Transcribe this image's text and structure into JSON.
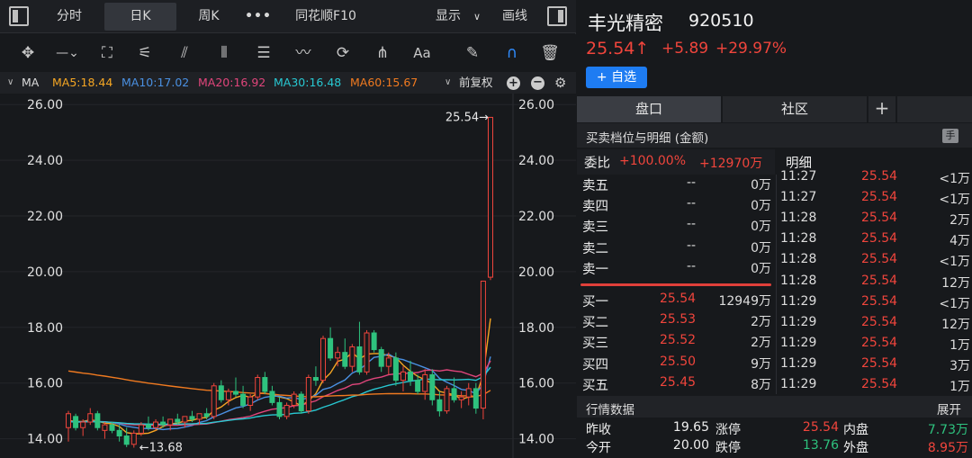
{
  "toolbar_top": {
    "tabs": [
      "分时",
      "日K",
      "周K",
      "•••",
      "同花顺F10"
    ],
    "display_label": "显示",
    "draw_label": "画线"
  },
  "drawing_tools": [
    "crosshair-icon",
    "horizontal-line-icon",
    "rectangle-icon",
    "fan-icon",
    "parallel-channel-icon",
    "vertical-lines-icon",
    "text-box-icon",
    "wave-icon",
    "cycle-icon",
    "fork-icon",
    "font-icon",
    "pen-icon",
    "magnet-icon",
    "trash-icon"
  ],
  "drawing_tool_labels": {
    "font": "Aa"
  },
  "ma_bar": {
    "label": "MA",
    "items": [
      {
        "text": "MA5:18.44",
        "color": "#f5a623"
      },
      {
        "text": "MA10:17.02",
        "color": "#4a90e2"
      },
      {
        "text": "MA20:16.92",
        "color": "#e0457b"
      },
      {
        "text": "MA30:16.48",
        "color": "#28c8d2"
      },
      {
        "text": "MA60:15.67",
        "color": "#f07a20"
      }
    ],
    "adjust": "前复权"
  },
  "chart_data": {
    "type": "candlestick",
    "ylim": [
      13.6,
      26.2
    ],
    "yticks": [
      "26.00",
      "24.00",
      "22.00",
      "20.00",
      "18.00",
      "16.00",
      "14.00"
    ],
    "annotations": {
      "high": "25.54→",
      "low": "←13.68"
    },
    "ohlc": [
      [
        14.4,
        15.0,
        13.9,
        14.9
      ],
      [
        14.8,
        14.9,
        14.3,
        14.4
      ],
      [
        14.4,
        14.7,
        14.1,
        14.6
      ],
      [
        14.6,
        15.1,
        14.5,
        14.9
      ],
      [
        14.9,
        15.0,
        14.3,
        14.4
      ],
      [
        14.3,
        14.6,
        14.0,
        14.5
      ],
      [
        14.5,
        14.6,
        14.2,
        14.3
      ],
      [
        14.3,
        14.5,
        13.9,
        14.1
      ],
      [
        14.1,
        14.4,
        13.7,
        13.8
      ],
      [
        13.8,
        14.3,
        13.68,
        14.2
      ],
      [
        14.2,
        14.6,
        14.1,
        14.5
      ],
      [
        14.5,
        14.8,
        14.3,
        14.4
      ],
      [
        14.4,
        14.7,
        14.3,
        14.6
      ],
      [
        14.6,
        14.8,
        14.4,
        14.5
      ],
      [
        14.5,
        14.7,
        14.3,
        14.7
      ],
      [
        14.7,
        14.9,
        14.5,
        14.6
      ],
      [
        14.6,
        14.8,
        14.4,
        14.8
      ],
      [
        14.8,
        15.0,
        14.6,
        14.7
      ],
      [
        14.7,
        14.9,
        14.5,
        14.9
      ],
      [
        14.9,
        15.1,
        14.7,
        14.8
      ],
      [
        14.8,
        16.0,
        14.7,
        15.9
      ],
      [
        15.9,
        16.1,
        15.3,
        15.4
      ],
      [
        15.4,
        15.8,
        15.2,
        15.7
      ],
      [
        15.7,
        16.2,
        15.5,
        15.6
      ],
      [
        15.6,
        15.9,
        15.1,
        15.2
      ],
      [
        15.2,
        15.6,
        15.0,
        15.5
      ],
      [
        15.5,
        16.3,
        15.4,
        16.2
      ],
      [
        16.2,
        16.4,
        15.6,
        15.7
      ],
      [
        15.7,
        15.9,
        15.2,
        15.3
      ],
      [
        15.3,
        15.5,
        14.7,
        14.8
      ],
      [
        14.8,
        15.3,
        14.7,
        15.2
      ],
      [
        15.2,
        15.7,
        15.1,
        15.6
      ],
      [
        15.6,
        15.7,
        14.9,
        15.0
      ],
      [
        15.0,
        16.3,
        14.9,
        16.2
      ],
      [
        16.2,
        16.6,
        15.9,
        16.1
      ],
      [
        16.1,
        17.7,
        16.0,
        17.6
      ],
      [
        17.6,
        18.0,
        16.8,
        16.9
      ],
      [
        16.9,
        17.3,
        16.6,
        17.1
      ],
      [
        17.1,
        17.6,
        16.5,
        16.6
      ],
      [
        16.6,
        17.4,
        16.4,
        17.3
      ],
      [
        17.3,
        18.2,
        16.3,
        16.4
      ],
      [
        16.4,
        17.9,
        16.3,
        17.8
      ],
      [
        17.8,
        17.9,
        17.1,
        17.2
      ],
      [
        17.2,
        17.3,
        16.4,
        16.6
      ],
      [
        16.6,
        17.1,
        16.3,
        16.9
      ],
      [
        16.9,
        17.1,
        15.9,
        16.1
      ],
      [
        16.1,
        16.6,
        15.7,
        16.4
      ],
      [
        16.4,
        16.8,
        15.9,
        16.1
      ],
      [
        16.1,
        16.3,
        15.6,
        15.7
      ],
      [
        15.7,
        16.5,
        15.4,
        16.3
      ],
      [
        16.3,
        16.5,
        15.2,
        15.4
      ],
      [
        15.4,
        15.7,
        14.8,
        15.0
      ],
      [
        15.0,
        15.9,
        14.9,
        15.8
      ],
      [
        15.8,
        16.2,
        15.3,
        15.4
      ],
      [
        15.4,
        15.7,
        15.1,
        15.5
      ],
      [
        15.5,
        16.0,
        15.2,
        15.8
      ],
      [
        15.8,
        16.0,
        14.9,
        15.1
      ],
      [
        15.1,
        19.66,
        14.7,
        19.66
      ],
      [
        19.8,
        25.54,
        19.7,
        25.54
      ]
    ]
  },
  "stock": {
    "name": "丰光精密",
    "code": "920510",
    "price": "25.54",
    "arrow": "↑",
    "change": "+5.89",
    "pct": "+29.97%",
    "watch_label": "+ 自选"
  },
  "right_tabs": [
    "盘口",
    "社区",
    "+"
  ],
  "detail_header": "买卖档位与明细 (金额)",
  "detail_badge": "手",
  "weibi": {
    "label": "委比",
    "pct": "+100.00%",
    "amount": "+12970万"
  },
  "mingxi_label": "明细",
  "sell_levels": [
    {
      "label": "卖五",
      "price": "--",
      "vol": "0万"
    },
    {
      "label": "卖四",
      "price": "--",
      "vol": "0万"
    },
    {
      "label": "卖三",
      "price": "--",
      "vol": "0万"
    },
    {
      "label": "卖二",
      "price": "--",
      "vol": "0万"
    },
    {
      "label": "卖一",
      "price": "--",
      "vol": "0万"
    }
  ],
  "buy_levels": [
    {
      "label": "买一",
      "price": "25.54",
      "vol": "12949万"
    },
    {
      "label": "买二",
      "price": "25.53",
      "vol": "2万"
    },
    {
      "label": "买三",
      "price": "25.52",
      "vol": "2万"
    },
    {
      "label": "买四",
      "price": "25.50",
      "vol": "9万"
    },
    {
      "label": "买五",
      "price": "25.45",
      "vol": "8万"
    }
  ],
  "trades": [
    {
      "time": "11:27",
      "price": "25.54",
      "vol": "<1万"
    },
    {
      "time": "11:27",
      "price": "25.54",
      "vol": "<1万"
    },
    {
      "time": "11:28",
      "price": "25.54",
      "vol": "2万"
    },
    {
      "time": "11:28",
      "price": "25.54",
      "vol": "4万"
    },
    {
      "time": "11:28",
      "price": "25.54",
      "vol": "<1万"
    },
    {
      "time": "11:28",
      "price": "25.54",
      "vol": "12万"
    },
    {
      "time": "11:29",
      "price": "25.54",
      "vol": "<1万"
    },
    {
      "time": "11:29",
      "price": "25.54",
      "vol": "12万"
    },
    {
      "time": "11:29",
      "price": "25.54",
      "vol": "1万"
    },
    {
      "time": "11:29",
      "price": "25.54",
      "vol": "3万"
    },
    {
      "time": "11:29",
      "price": "25.54",
      "vol": "1万"
    }
  ],
  "market": {
    "title": "行情数据",
    "expand": "展开",
    "rows": [
      {
        "l1": "昨收",
        "v1": "19.65",
        "l2": "涨停",
        "v2": "25.54",
        "l3": "内盘",
        "v3": "7.73万"
      },
      {
        "l1": "今开",
        "v1": "20.00",
        "l2": "跌停",
        "v2": "13.76",
        "l3": "外盘",
        "v3": "8.95万"
      }
    ]
  },
  "colors": {
    "up": "#f0453c",
    "down": "#2ec27e",
    "accent": "#1e7cf2",
    "bg": "#17191c"
  }
}
